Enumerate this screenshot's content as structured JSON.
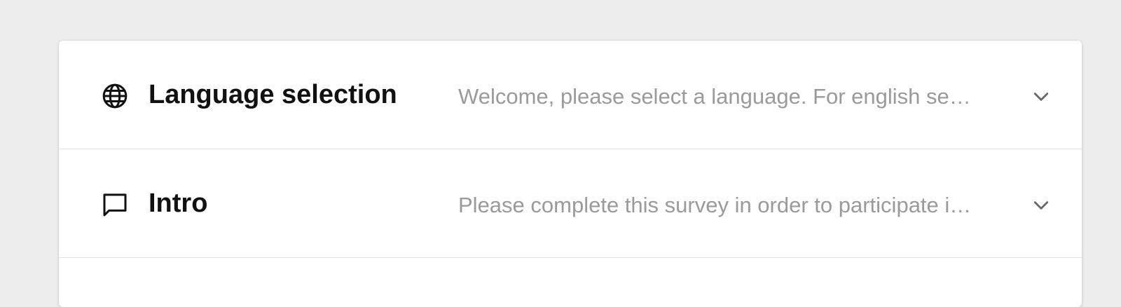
{
  "sections": [
    {
      "icon": "globe-icon",
      "title": "Language selection",
      "summary": "Welcome, please select a language. For english send..."
    },
    {
      "icon": "chat-bubble-icon",
      "title": "Intro",
      "summary": "Please complete this survey in order to participate in..."
    }
  ],
  "colors": {
    "page_background": "#ededed",
    "card_background": "#ffffff",
    "title_text": "#111111",
    "summary_text": "#9a9a9a",
    "divider": "#e2e2e2"
  }
}
